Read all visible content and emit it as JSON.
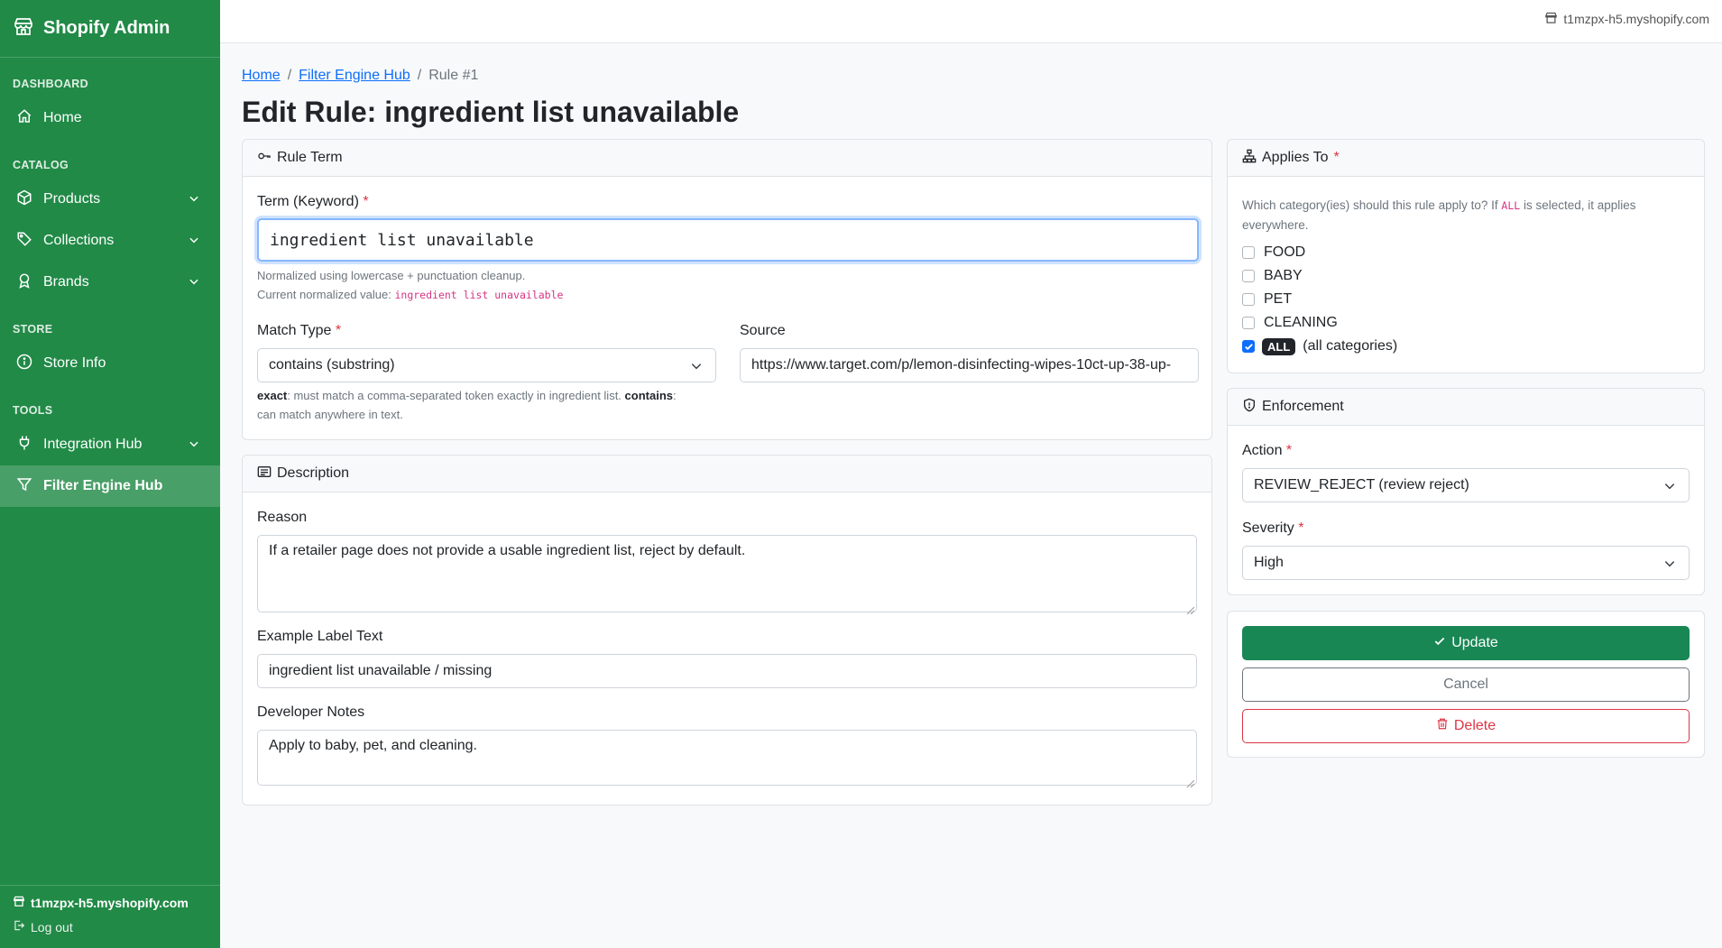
{
  "sidebar": {
    "brand": "Shopify Admin",
    "sections": {
      "dashboard": "DASHBOARD",
      "catalog": "CATALOG",
      "store": "STORE",
      "tools": "TOOLS"
    },
    "items": {
      "home": "Home",
      "products": "Products",
      "collections": "Collections",
      "brands": "Brands",
      "store_info": "Store Info",
      "integration_hub": "Integration Hub",
      "filter_engine_hub": "Filter Engine Hub"
    },
    "footer": {
      "store": "t1mzpx-h5.myshopify.com",
      "logout": "Log out"
    }
  },
  "topbar": {
    "shop": "t1mzpx-h5.myshopify.com"
  },
  "breadcrumb": {
    "home": "Home",
    "hub": "Filter Engine Hub",
    "current": "Rule #1",
    "sep": "/"
  },
  "page_title": "Edit Rule: ingredient list unavailable",
  "rule_term": {
    "header": "Rule Term",
    "term_label": "Term (Keyword)",
    "term_value": "ingredient list unavailable",
    "help1": "Normalized using lowercase + punctuation cleanup.",
    "help2_prefix": "Current normalized value:",
    "normalized": "ingredient list unavailable",
    "match_label": "Match Type",
    "match_value": "contains (substring)",
    "match_help_exact": "exact",
    "match_help_1": ": must match a comma-separated token exactly in ingredient list. ",
    "match_help_contains": "contains",
    "match_help_2": ":",
    "match_help_3": "can match anywhere in text.",
    "source_label": "Source",
    "source_value": "https://www.target.com/p/lemon-disinfecting-wipes-10ct-up-38-up-"
  },
  "description": {
    "header": "Description",
    "reason_label": "Reason",
    "reason_value": "If a retailer page does not provide a usable ingredient list, reject by default.",
    "example_label": "Example Label Text",
    "example_value": "ingredient list unavailable / missing",
    "notes_label": "Developer Notes",
    "notes_value": "Apply to baby, pet, and cleaning."
  },
  "applies_to": {
    "header": "Applies To",
    "help_prefix": "Which category(ies) should this rule apply to? If",
    "help_code": "ALL",
    "help_suffix": "is selected, it applies",
    "help_line2": "everywhere.",
    "options": {
      "food": "FOOD",
      "baby": "BABY",
      "pet": "PET",
      "cleaning": "CLEANING",
      "all_badge": "ALL",
      "all_text": "(all categories)"
    }
  },
  "enforcement": {
    "header": "Enforcement",
    "action_label": "Action",
    "action_value": "REVIEW_REJECT (review reject)",
    "severity_label": "Severity",
    "severity_value": "High"
  },
  "actions": {
    "update": "Update",
    "cancel": "Cancel",
    "delete": "Delete"
  },
  "colors": {
    "sidebar": "#218a47",
    "primary": "#198754",
    "danger": "#dc3545",
    "link": "#0d6efd"
  }
}
